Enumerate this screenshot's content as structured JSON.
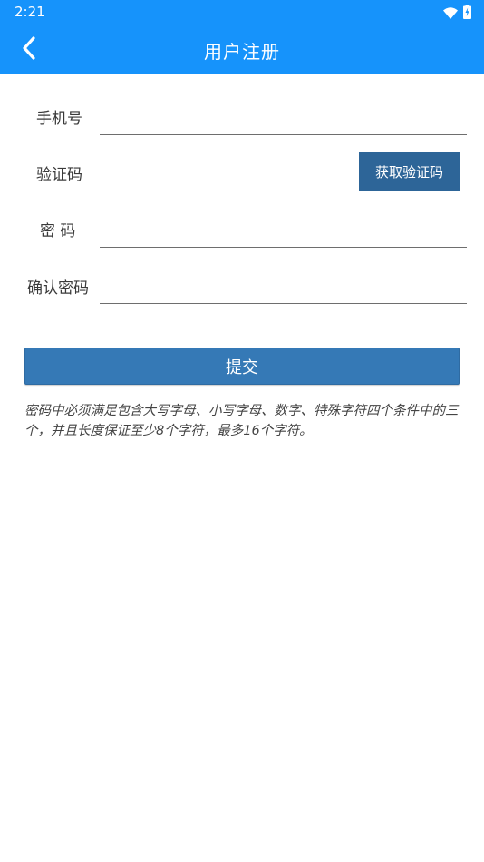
{
  "status_bar": {
    "time": "2:21",
    "icons": [
      "wifi-icon",
      "battery-charging-icon"
    ]
  },
  "app_bar": {
    "back_icon": "chevron-left-icon",
    "title": "用户注册"
  },
  "form": {
    "phone": {
      "label": "手机号",
      "value": ""
    },
    "code": {
      "label": "验证码",
      "value": "",
      "button_label": "获取验证码"
    },
    "password": {
      "label": "密 码",
      "value": ""
    },
    "confirm_password": {
      "label": "确认密码",
      "value": ""
    }
  },
  "submit_label": "提交",
  "hint": "密码中必须满足包含大写字母、小写字母、数字、特殊字符四个条件中的三个，并且长度保证至少8个字符，最多16个字符。",
  "colors": {
    "header": "#1693fb",
    "code_button": "#2d6598",
    "submit_button": "#3579b6"
  }
}
